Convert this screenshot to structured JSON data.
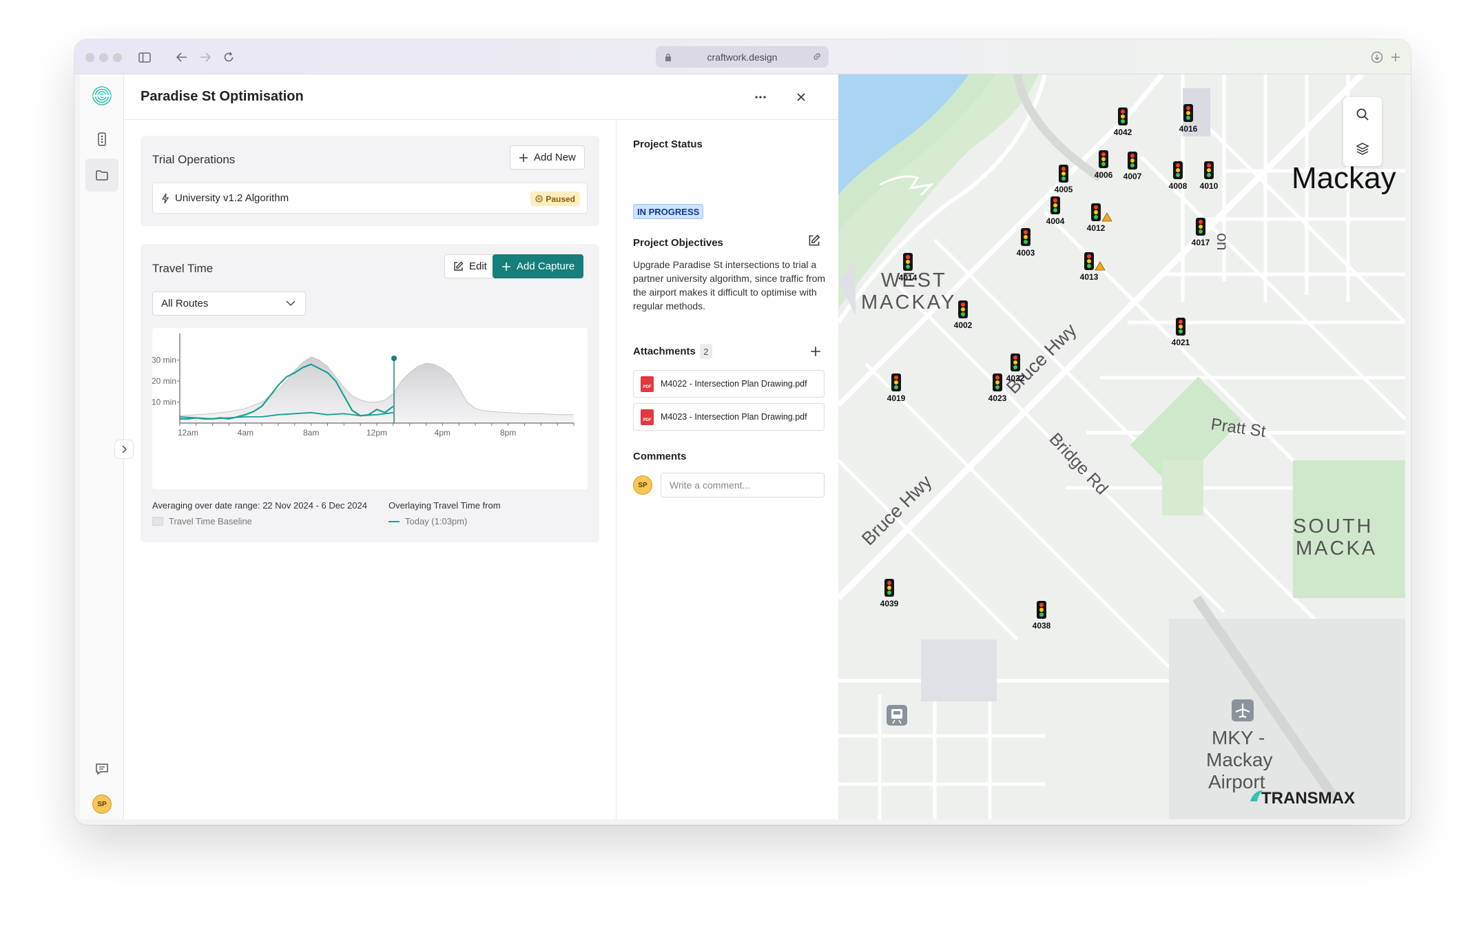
{
  "browser": {
    "url": "craftwork.design"
  },
  "header": {
    "title": "Paradise St Optimisation"
  },
  "trial_operations": {
    "title": "Trial Operations",
    "add_label": "Add New",
    "item_name": "University v1.2 Algorithm",
    "item_status": "Paused"
  },
  "travel_time": {
    "title": "Travel Time",
    "edit_label": "Edit",
    "add_capture_label": "Add Capture",
    "route_select": "All Routes",
    "legend_left_title": "Averaging over date range: 22 Nov 2024 - 6 Dec 2024",
    "legend_left_item": "Travel Time Baseline",
    "legend_right_title": "Overlaying Travel Time from",
    "legend_right_item": "Today (1:03pm)"
  },
  "chart_data": {
    "type": "area",
    "x_ticks": [
      "12am",
      "4am",
      "8am",
      "12pm",
      "4pm",
      "8pm"
    ],
    "y_ticks": [
      "10 min",
      "20 min",
      "30 min"
    ],
    "xlim": [
      0,
      24
    ],
    "ylim": [
      0,
      42
    ],
    "cursor_x": 13.05,
    "series": [
      {
        "name": "Travel Time Baseline",
        "kind": "area",
        "x": [
          0,
          1,
          2,
          3,
          4,
          5,
          6,
          6.5,
          7,
          7.5,
          8,
          8.5,
          9,
          9.5,
          10,
          10.5,
          11,
          11.5,
          12,
          12.5,
          13,
          13.5,
          14,
          14.5,
          15,
          15.5,
          16,
          16.5,
          17,
          17.5,
          18,
          18.5,
          19,
          20,
          21,
          22,
          23,
          24
        ],
        "y": [
          3.5,
          4,
          4.5,
          5.5,
          7,
          10,
          16,
          20,
          25,
          29,
          31.5,
          30,
          27,
          22,
          17,
          13,
          11,
          10,
          10,
          11,
          14,
          20,
          24,
          27,
          28.5,
          28,
          26,
          23,
          17,
          10,
          7,
          6,
          5.5,
          5,
          4.5,
          4.5,
          4,
          4
        ]
      },
      {
        "name": "Today (1:03pm)",
        "kind": "line",
        "x": [
          0,
          0.5,
          1,
          1.5,
          2,
          2.5,
          3,
          3.5,
          4,
          4.5,
          5,
          5.5,
          6,
          6.5,
          7,
          7.5,
          8,
          8.5,
          9,
          9.5,
          10,
          10.5,
          11,
          11.5,
          12,
          12.5,
          13
        ],
        "y": [
          2,
          2,
          2.5,
          2,
          2,
          2.5,
          2,
          3,
          4,
          5.5,
          8,
          13,
          18,
          22,
          24,
          26.5,
          28,
          26,
          24,
          20,
          13,
          6,
          3.5,
          4,
          6.5,
          5,
          8
        ]
      },
      {
        "name": "Secondary",
        "kind": "line",
        "x": [
          0,
          1,
          2,
          3,
          4,
          5,
          6,
          7,
          8,
          9,
          10,
          11,
          12,
          13
        ],
        "y": [
          3,
          2.5,
          2,
          2.5,
          3,
          3,
          4,
          4.5,
          5,
          4,
          4.5,
          3.5,
          4,
          5
        ]
      }
    ]
  },
  "project": {
    "status_label": "Project Status",
    "status_value": "IN PROGRESS",
    "objectives_label": "Project Objectives",
    "objectives_text": "Upgrade Paradise St intersections to trial a partner university algorithm, since traffic from the airport makes it difficult to optimise with regular methods.",
    "attachments_label": "Attachments",
    "attachments_count": "2",
    "attachments": [
      "M4022 - Intersection Plan Drawing.pdf",
      "M4023 - Intersection Plan Drawing.pdf"
    ],
    "comments_label": "Comments",
    "comment_placeholder": "Write a comment...",
    "avatar_initials": "SP"
  },
  "user": {
    "initials": "SP"
  },
  "map": {
    "labels": {
      "mackay": "Mackay",
      "west": "WEST",
      "west2": "MACKAY",
      "south": "SOUTH",
      "south2": "MACKA",
      "bruce1": "Bruce Hwy",
      "bruce2": "Bruce Hwy",
      "bridge": "Bridge Rd",
      "pratt": "Pratt St",
      "airport1": "MKY -",
      "airport2": "Mackay",
      "airport3": "Airport",
      "partial": "on"
    },
    "brand": "TRANSMAX",
    "signals": [
      "4042",
      "4016",
      "4006",
      "4007",
      "4008",
      "4010",
      "4005",
      "4004",
      "4012",
      "4017",
      "4003",
      "4013",
      "4014",
      "4002",
      "4021",
      "4022",
      "4023",
      "4019",
      "4039",
      "4038"
    ],
    "warning_signals": [
      "4012",
      "4013"
    ]
  }
}
